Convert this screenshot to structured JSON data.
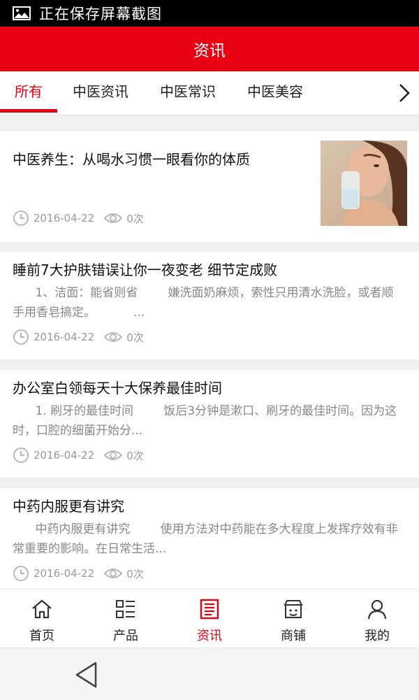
{
  "status_bar": {
    "text": "正在保存屏幕截图"
  },
  "header": {
    "title": "资讯"
  },
  "tabs": [
    {
      "label": "所有",
      "active": true
    },
    {
      "label": "中医资讯",
      "active": false
    },
    {
      "label": "中医常识",
      "active": false
    },
    {
      "label": "中医美容",
      "active": false
    }
  ],
  "articles": [
    {
      "title": "中医养生：从喝水习惯一眼看你的体质",
      "excerpt": "",
      "date": "2016-04-22",
      "views": "0次",
      "thumbnail": "woman-drinking-water"
    },
    {
      "title": "睡前7大护肤错误让你一夜变老 细节定成败",
      "excerpt": "      1、洁面：能省则省        嫌洗面奶麻烦，索性只用清水洗脸，或者顺手用香皂搞定。          ...",
      "date": "2016-04-22",
      "views": "0次"
    },
    {
      "title": "办公室白领每天十大保养最佳时间",
      "excerpt": "      1. 刷牙的最佳时间        饭后3分钟是漱口、刷牙的最佳时间。因为这时，口腔的细菌开始分...",
      "date": "2016-04-22",
      "views": "0次"
    },
    {
      "title": "中药内服更有讲究",
      "excerpt": "      中药内服更有讲究        使用方法对中药能在多大程度上发挥疗效有非常重要的影响。在日常生活...",
      "date": "2016-04-22",
      "views": "0次"
    }
  ],
  "bottom_nav": [
    {
      "label": "首页",
      "icon": "home-icon",
      "active": false
    },
    {
      "label": "产品",
      "icon": "list-icon",
      "active": false
    },
    {
      "label": "资讯",
      "icon": "news-icon",
      "active": true
    },
    {
      "label": "商铺",
      "icon": "shop-icon",
      "active": false
    },
    {
      "label": "我的",
      "icon": "user-icon",
      "active": false
    }
  ],
  "colors": {
    "accent": "#e60012",
    "text": "#222222",
    "muted": "#999999"
  }
}
